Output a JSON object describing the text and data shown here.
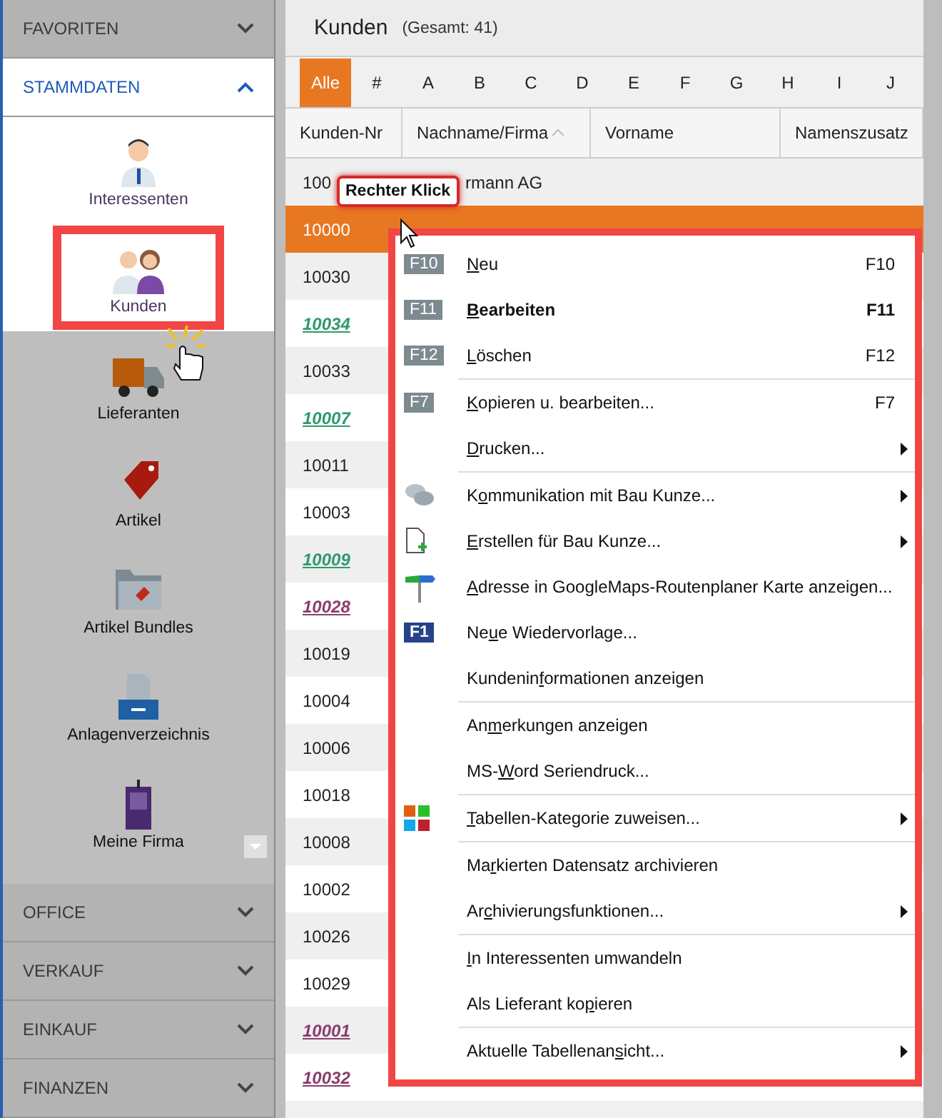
{
  "sidebar": {
    "sections": [
      {
        "title": "FAVORITEN",
        "expanded": false
      },
      {
        "title": "STAMMDATEN",
        "expanded": true,
        "items": [
          {
            "label": "Interessenten",
            "spotlight": true,
            "selected": false
          },
          {
            "label": "Kunden",
            "spotlight": true,
            "selected": true
          },
          {
            "label": "Lieferanten",
            "spotlight": false,
            "selected": false
          },
          {
            "label": "Artikel",
            "spotlight": false,
            "selected": false
          },
          {
            "label": "Artikel Bundles",
            "spotlight": false,
            "selected": false
          },
          {
            "label": "Anlagenverzeichnis",
            "spotlight": false,
            "selected": false
          },
          {
            "label": "Meine Firma",
            "spotlight": false,
            "selected": false
          }
        ]
      },
      {
        "title": "OFFICE",
        "expanded": false
      },
      {
        "title": "VERKAUF",
        "expanded": false
      },
      {
        "title": "EINKAUF",
        "expanded": false
      },
      {
        "title": "FINANZEN",
        "expanded": false
      }
    ]
  },
  "main": {
    "title": "Kunden",
    "count": "(Gesamt: 41)",
    "letters": [
      {
        "label": "Alle",
        "selected": true
      },
      {
        "label": "#",
        "selected": false
      },
      {
        "label": "A",
        "selected": false
      },
      {
        "label": "B",
        "selected": false
      },
      {
        "label": "C",
        "selected": false
      },
      {
        "label": "D",
        "selected": false
      },
      {
        "label": "E",
        "selected": false
      },
      {
        "label": "F",
        "selected": false
      },
      {
        "label": "G",
        "selected": false
      },
      {
        "label": "H",
        "selected": false
      },
      {
        "label": "I",
        "selected": false
      },
      {
        "label": "J",
        "selected": false
      }
    ],
    "columns": [
      "Kunden-Nr",
      "Nachname/Firma",
      "Vorname",
      "Namenszusatz"
    ],
    "rows": [
      {
        "kunden_nr": "100",
        "name": "rmann AG",
        "selected": false,
        "link": false
      },
      {
        "kunden_nr": "10000",
        "selected": true,
        "link": false
      },
      {
        "kunden_nr": "10030",
        "selected": false,
        "link": false
      },
      {
        "kunden_nr": "10034",
        "selected": false,
        "link": true,
        "color": "#2e9a6e"
      },
      {
        "kunden_nr": "10033",
        "selected": false,
        "link": false
      },
      {
        "kunden_nr": "10007",
        "selected": false,
        "link": true,
        "color": "#2e9a6e"
      },
      {
        "kunden_nr": "10011",
        "selected": false,
        "link": false
      },
      {
        "kunden_nr": "10003",
        "selected": false,
        "link": false
      },
      {
        "kunden_nr": "10009",
        "selected": false,
        "link": true,
        "color": "#2e9a6e"
      },
      {
        "kunden_nr": "10028",
        "selected": false,
        "link": true,
        "color": "#8a3d6e"
      },
      {
        "kunden_nr": "10019",
        "selected": false,
        "link": false
      },
      {
        "kunden_nr": "10004",
        "selected": false,
        "link": false
      },
      {
        "kunden_nr": "10006",
        "selected": false,
        "link": false
      },
      {
        "kunden_nr": "10018",
        "selected": false,
        "link": false
      },
      {
        "kunden_nr": "10008",
        "selected": false,
        "link": false
      },
      {
        "kunden_nr": "10002",
        "selected": false,
        "link": false
      },
      {
        "kunden_nr": "10026",
        "selected": false,
        "link": false
      },
      {
        "kunden_nr": "10029",
        "selected": false,
        "link": false
      },
      {
        "kunden_nr": "10001",
        "selected": false,
        "link": true,
        "color": "#8a3d6e"
      },
      {
        "kunden_nr": "10032",
        "selected": false,
        "link": true,
        "color": "#8a3d6e"
      }
    ]
  },
  "callout": "Rechter Klick",
  "context_menu": [
    {
      "kind": "function_key",
      "badge": "F10",
      "key": "N",
      "post": "eu",
      "shortcut": "F10",
      "bold": false,
      "submenu": false,
      "separator_after": false
    },
    {
      "kind": "function_key",
      "badge": "F11",
      "key": "B",
      "post": "earbeiten",
      "shortcut": "F11",
      "bold": true,
      "submenu": false,
      "separator_after": false
    },
    {
      "kind": "function_key",
      "badge": "F12",
      "key": "L",
      "post": "öschen",
      "shortcut": "F12",
      "bold": false,
      "submenu": false,
      "separator_after": true
    },
    {
      "kind": "function_key",
      "badge": "F7",
      "key": "K",
      "post": "opieren u. bearbeiten...",
      "shortcut": "F7",
      "bold": false,
      "submenu": false,
      "separator_after": false
    },
    {
      "kind": "text",
      "key": "D",
      "post": "rucken...",
      "bold": false,
      "submenu": true,
      "separator_after": true
    },
    {
      "kind": "icon",
      "pre": "K",
      "key": "o",
      "post": "mmunikation mit Bau Kunze...",
      "bold": false,
      "submenu": true,
      "separator_after": false
    },
    {
      "kind": "icon",
      "key": "E",
      "post": "rstellen für Bau Kunze...",
      "bold": false,
      "submenu": true,
      "separator_after": false
    },
    {
      "kind": "icon",
      "key": "A",
      "post": "dresse in GoogleMaps-Routenplaner Karte anzeigen...",
      "bold": false,
      "submenu": false,
      "separator_after": false
    },
    {
      "kind": "reminder_key",
      "badge": "F1",
      "pre": "Ne",
      "key": "u",
      "post": "e Wiedervorlage...",
      "bold": false,
      "submenu": false,
      "separator_after": false
    },
    {
      "kind": "text",
      "pre": "Kundenin",
      "key": "f",
      "post": "ormationen anzeigen",
      "bold": false,
      "submenu": false,
      "separator_after": true
    },
    {
      "kind": "text",
      "pre": "An",
      "key": "m",
      "post": "erkungen anzeigen",
      "bold": false,
      "submenu": false,
      "separator_after": false
    },
    {
      "kind": "text",
      "pre": "MS-",
      "key": "W",
      "post": "ord Seriendruck...",
      "bold": false,
      "submenu": false,
      "separator_after": true
    },
    {
      "kind": "icon",
      "key": "T",
      "post": "abellen-Kategorie zuweisen...",
      "bold": false,
      "submenu": true,
      "separator_after": true
    },
    {
      "kind": "text",
      "pre": "Ma",
      "key": "r",
      "post": "kierten Datensatz archivieren",
      "bold": false,
      "submenu": false,
      "separator_after": false
    },
    {
      "kind": "text",
      "pre": "Ar",
      "key": "c",
      "post": "hivierungsfunktionen...",
      "bold": false,
      "submenu": true,
      "separator_after": true
    },
    {
      "kind": "text",
      "key": "I",
      "post": "n Interessenten umwandeln",
      "bold": false,
      "submenu": false,
      "separator_after": false
    },
    {
      "kind": "text",
      "pre": "Als Lieferant ko",
      "key": "p",
      "post": "ieren",
      "bold": false,
      "submenu": false,
      "separator_after": true
    },
    {
      "kind": "text",
      "pre": "Aktuelle Tabellenan",
      "key": "s",
      "post": "icht...",
      "bold": false,
      "submenu": true,
      "separator_after": false
    }
  ]
}
